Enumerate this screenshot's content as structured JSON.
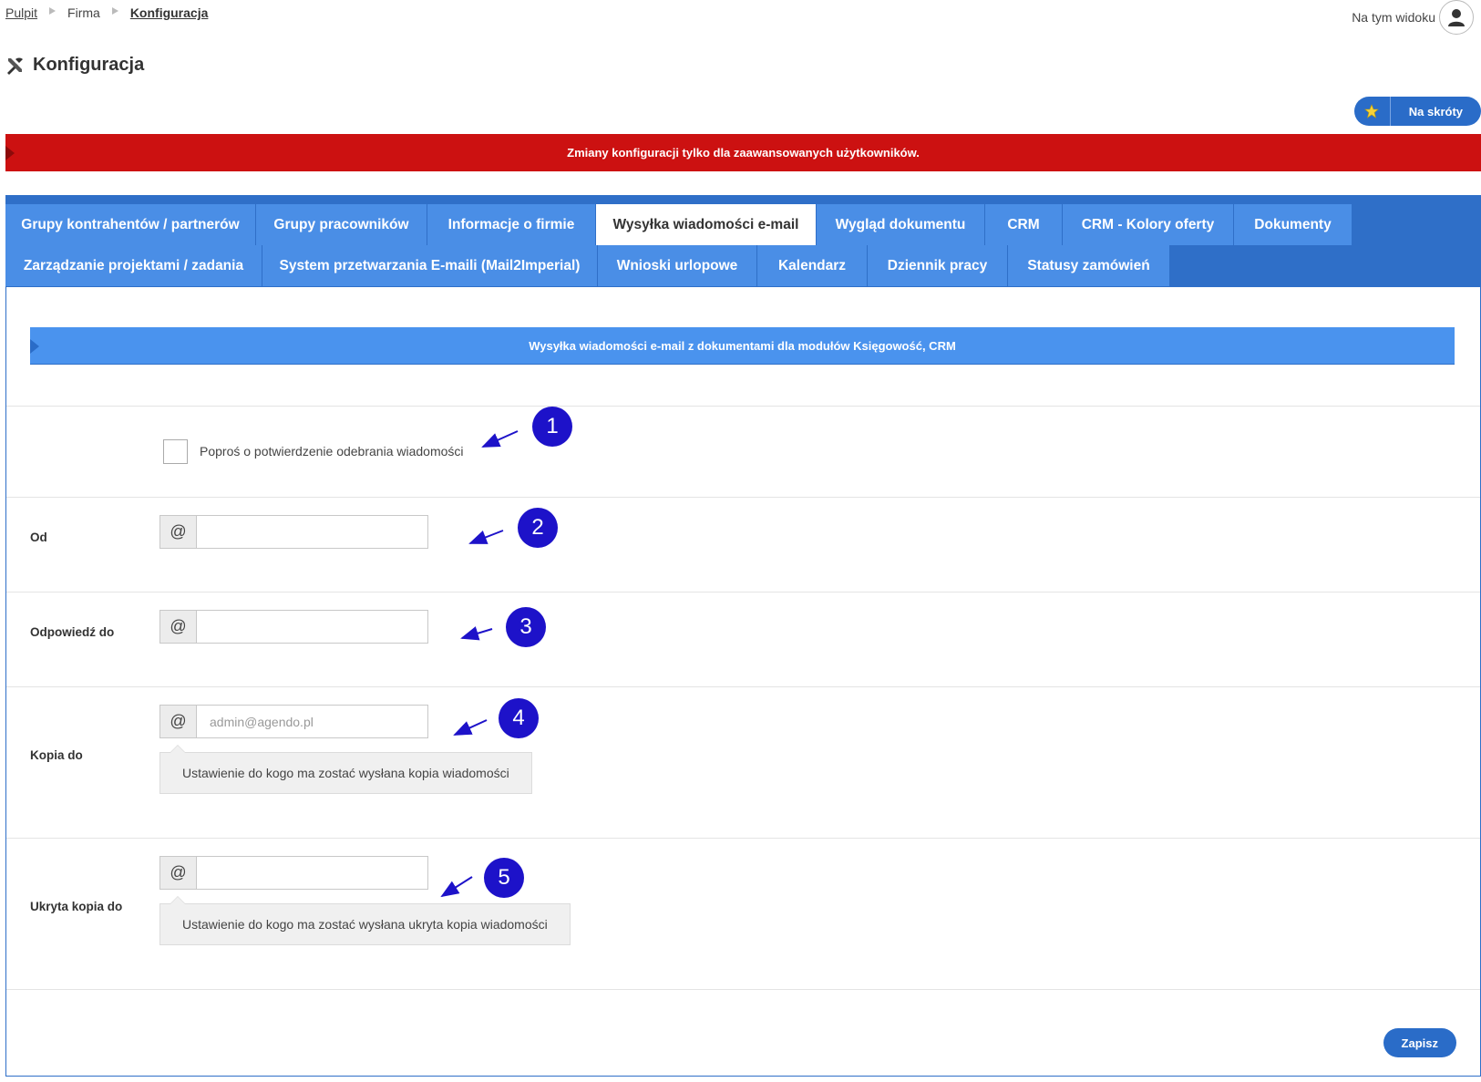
{
  "breadcrumb": {
    "items": [
      "Pulpit",
      "Firma",
      "Konfiguracja"
    ]
  },
  "header": {
    "view_label": "Na tym widoku",
    "page_title": "Konfiguracja",
    "shortcuts_label": "Na skróty"
  },
  "warning": {
    "text": "Zmiany konfiguracji tylko dla zaawansowanych użytkowników."
  },
  "tabs": {
    "row1": [
      "Grupy kontrahentów / partnerów",
      "Grupy pracowników",
      "Informacje o firmie",
      "Wysyłka wiadomości e-mail",
      "Wygląd dokumentu",
      "CRM",
      "CRM - Kolory oferty",
      "Dokumenty"
    ],
    "row2": [
      "Zarządzanie projektami / zadania",
      "System przetwarzania E-maili (Mail2Imperial)",
      "Wnioski urlopowe",
      "Kalendarz",
      "Dziennik pracy",
      "Statusy zamówień"
    ],
    "active": "Wysyłka wiadomości e-mail"
  },
  "section": {
    "title": "Wysyłka wiadomości e-mail z dokumentami dla modułów Księgowość, CRM"
  },
  "form": {
    "read_receipt_label": "Poproś o potwierdzenie odebrania wiadomości",
    "at_symbol": "@",
    "from_label": "Od",
    "from_value": "",
    "reply_to_label": "Odpowiedź do",
    "reply_to_value": "",
    "cc_label": "Kopia do",
    "cc_placeholder": "admin@agendo.pl",
    "cc_hint": "Ustawienie do kogo ma zostać wysłana kopia wiadomości",
    "bcc_label": "Ukryta kopia do",
    "bcc_value": "",
    "bcc_hint": "Ustawienie do kogo ma zostać wysłana ukryta kopia wiadomości",
    "save_label": "Zapisz"
  },
  "callouts": [
    "1",
    "2",
    "3",
    "4",
    "5"
  ],
  "colors": {
    "primary": "#2a6cc8",
    "tab": "#4a8ee6",
    "warning": "#cc1111",
    "callout": "#1d12c9"
  }
}
